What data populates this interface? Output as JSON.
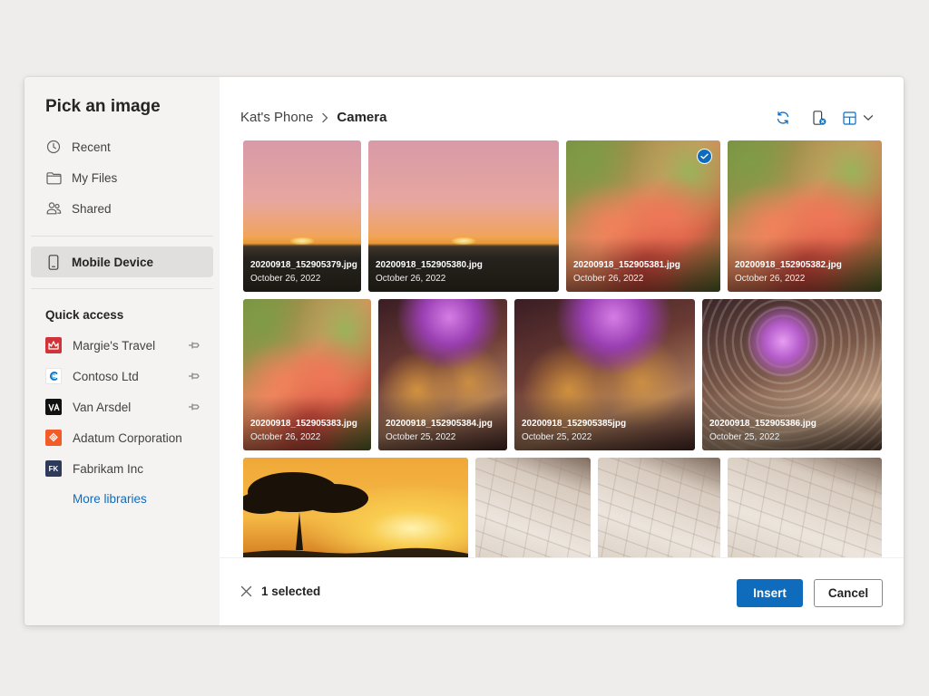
{
  "sidebar": {
    "title": "Pick an image",
    "nav": [
      {
        "label": "Recent",
        "icon": "clock-icon"
      },
      {
        "label": "My Files",
        "icon": "folder-icon"
      },
      {
        "label": "Shared",
        "icon": "people-icon"
      }
    ],
    "device": {
      "label": "Mobile Device",
      "icon": "phone-icon",
      "selected": true
    },
    "quick_access_label": "Quick access",
    "quick_access": [
      {
        "label": "Margie's Travel",
        "logo": "MT",
        "color": "#d13438",
        "pinned": true
      },
      {
        "label": "Contoso Ltd",
        "logo": "C",
        "color": "#ffffff",
        "pinned": true
      },
      {
        "label": "Van Arsdel",
        "logo": "VA",
        "color": "#111111",
        "pinned": true
      },
      {
        "label": "Adatum Corporation",
        "logo": "A",
        "color": "#f25c29",
        "pinned": false
      },
      {
        "label": "Fabrikam Inc",
        "logo": "FK",
        "color": "#2e3a5c",
        "pinned": false
      }
    ],
    "more_link": "More libraries"
  },
  "breadcrumb": {
    "parent": "Kat's Phone",
    "current": "Camera"
  },
  "toolbar": {
    "icons": [
      "sync-icon",
      "device-remove-icon",
      "layout-icon",
      "chevron-down-icon"
    ]
  },
  "photos": [
    {
      "name": "20200918_152905379.jpg",
      "date": "October 26, 2022",
      "kind": "sunset",
      "selected": false
    },
    {
      "name": "20200918_152905380.jpg",
      "date": "October 26, 2022",
      "kind": "sunset",
      "selected": false
    },
    {
      "name": "20200918_152905381.jpg",
      "date": "October 26, 2022",
      "kind": "plant",
      "selected": true
    },
    {
      "name": "20200918_152905382.jpg",
      "date": "October 26, 2022",
      "kind": "plant",
      "selected": false
    },
    {
      "name": "20200918_152905383.jpg",
      "date": "October 26, 2022",
      "kind": "plant",
      "selected": false
    },
    {
      "name": "20200918_152905384.jpg",
      "date": "October 25, 2022",
      "kind": "dome",
      "selected": false
    },
    {
      "name": "20200918_152905385jpg",
      "date": "October 25, 2022",
      "kind": "dome",
      "selected": false
    },
    {
      "name": "20200918_152905386.jpg",
      "date": "October 25, 2022",
      "kind": "dome2",
      "selected": false
    },
    {
      "name": "",
      "date": "",
      "kind": "tree",
      "selected": false
    },
    {
      "name": "",
      "date": "",
      "kind": "building",
      "selected": false
    },
    {
      "name": "",
      "date": "",
      "kind": "building",
      "selected": false
    },
    {
      "name": "",
      "date": "",
      "kind": "building",
      "selected": false
    }
  ],
  "footer": {
    "selected_text": "1 selected",
    "insert_label": "Insert",
    "cancel_label": "Cancel"
  },
  "colors": {
    "accent": "#0f6cbd",
    "sidebar_bg": "#f4f3f2",
    "selected_bg": "#e1dfdd"
  }
}
